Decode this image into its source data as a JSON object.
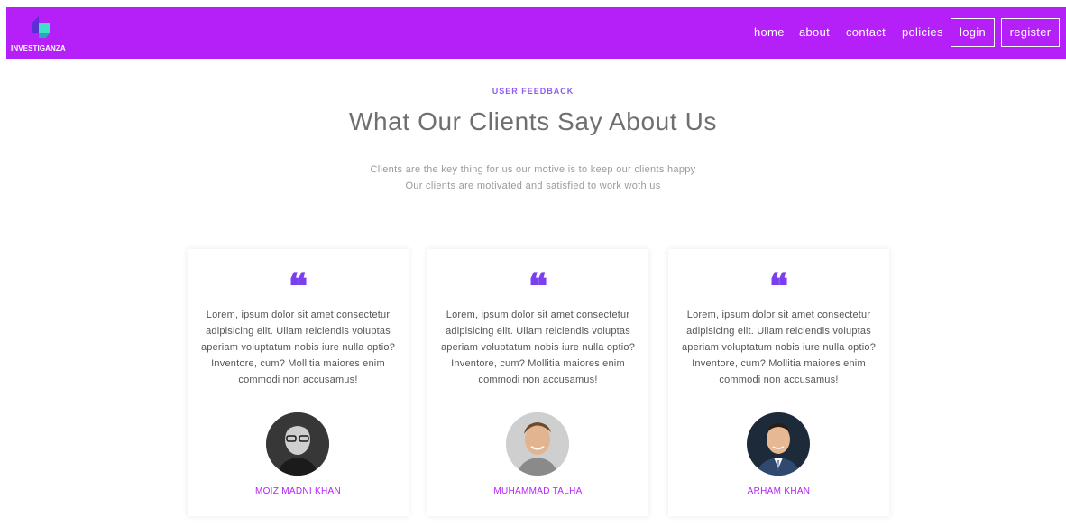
{
  "brand": {
    "name": "INVESTIGANZA",
    "logo_icon": "cube-logo-icon",
    "bar_color": "#b620f8"
  },
  "nav": {
    "links": [
      "home",
      "about",
      "contact",
      "policies"
    ],
    "login_label": "login",
    "register_label": "register"
  },
  "section": {
    "eyebrow": "USER FEEDBACK",
    "title": "What Our Clients Say About Us",
    "subtitle_line1": "Clients are the key thing for us our motive is to keep our clients happy",
    "subtitle_line2": "Our clients are motivated and satisfied to work woth us",
    "accent_color": "#8d5cf0"
  },
  "testimonials": [
    {
      "quote_mark": "❝",
      "text": "Lorem, ipsum dolor sit amet consectetur adipisicing elit. Ullam reiciendis voluptas aperiam voluptatum nobis iure nulla optio? Inventore, cum? Mollitia maiores enim commodi non accusamus!",
      "name": "MOIZ MADNI KHAN",
      "avatar": "avatar-photo"
    },
    {
      "quote_mark": "❝",
      "text": "Lorem, ipsum dolor sit amet consectetur adipisicing elit. Ullam reiciendis voluptas aperiam voluptatum nobis iure nulla optio? Inventore, cum? Mollitia maiores enim commodi non accusamus!",
      "name": "MUHAMMAD TALHA",
      "avatar": "avatar-photo"
    },
    {
      "quote_mark": "❝",
      "text": "Lorem, ipsum dolor sit amet consectetur adipisicing elit. Ullam reiciendis voluptas aperiam voluptatum nobis iure nulla optio? Inventore, cum? Mollitia maiores enim commodi non accusamus!",
      "name": "ARHAM KHAN",
      "avatar": "avatar-photo"
    }
  ]
}
